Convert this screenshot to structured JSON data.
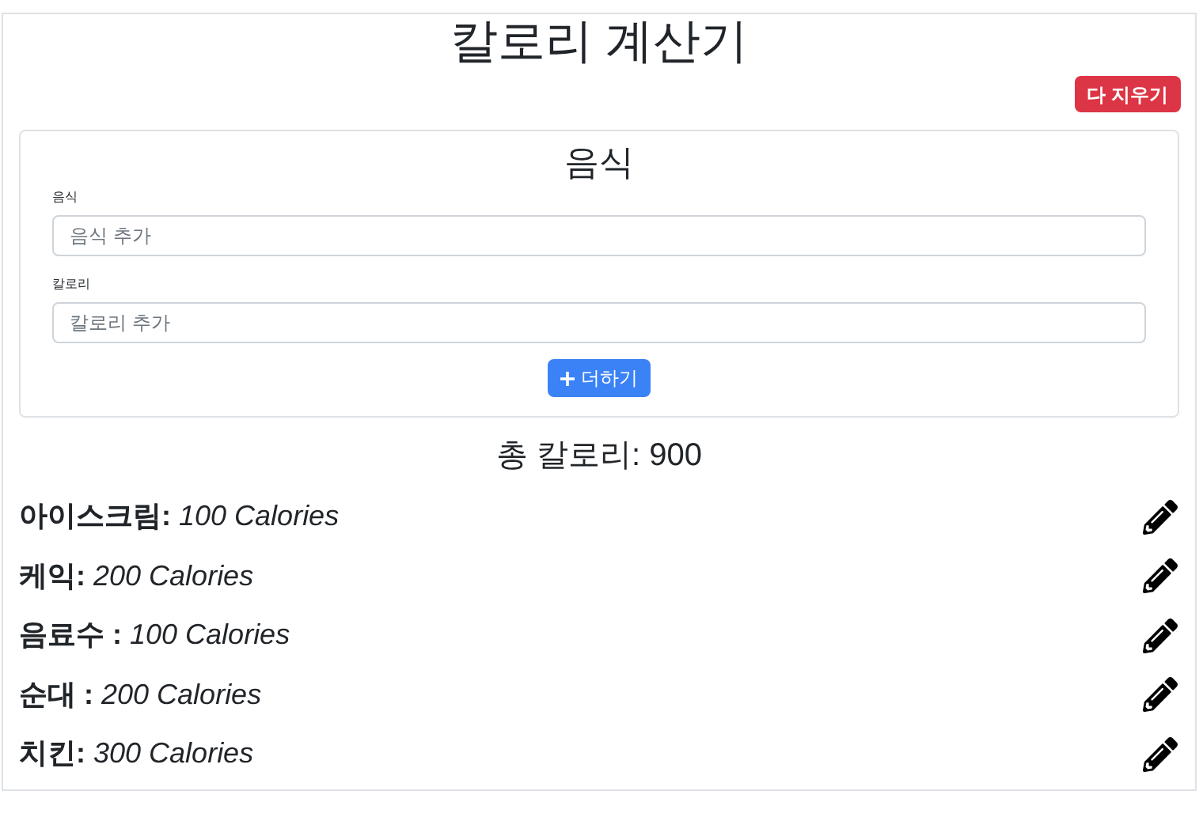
{
  "title": "칼로리 계산기",
  "clear_button": "다 지우기",
  "form": {
    "heading": "음식",
    "fields": [
      {
        "label": "음식",
        "placeholder": "음식 추가"
      },
      {
        "label": "칼로리",
        "placeholder": "칼로리 추가"
      }
    ],
    "add_button": "더하기"
  },
  "total": "총 칼로리: 900",
  "items": [
    {
      "text": "**아이스크림:** *100 Calories*"
    },
    {
      "text": "**케익:** *200 Calories*"
    },
    {
      "text": "**음료수 :** *100 Calories*"
    },
    {
      "text": "**순대 :** *200 Calories*"
    },
    {
      "text": "**치킨:** *300 Calories*"
    }
  ]
}
